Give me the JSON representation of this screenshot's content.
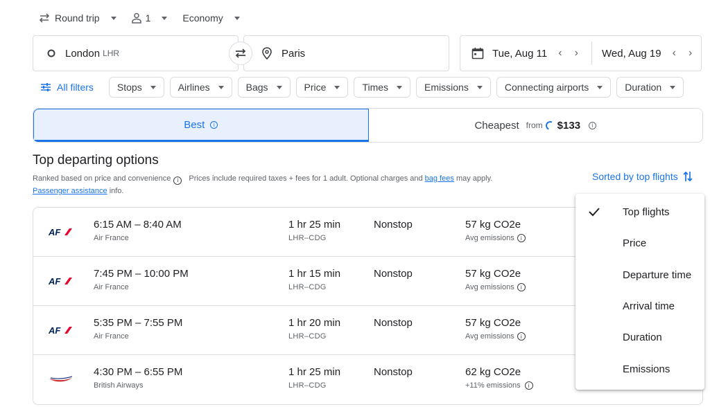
{
  "trip": {
    "type": "Round trip",
    "passengers": "1",
    "cabin": "Economy"
  },
  "search": {
    "origin": "London",
    "origin_code": "LHR",
    "destination": "Paris",
    "depart_date": "Tue, Aug 11",
    "return_date": "Wed, Aug 19"
  },
  "filters": {
    "all_filters": "All filters",
    "chips": [
      "Stops",
      "Airlines",
      "Bags",
      "Price",
      "Times",
      "Emissions",
      "Connecting airports",
      "Duration"
    ]
  },
  "tabs": {
    "best": "Best",
    "cheapest": "Cheapest",
    "from": "from",
    "cheapest_price": "$133"
  },
  "section": {
    "title": "Top departing options",
    "ranked": "Ranked based on price and convenience",
    "prices_note": "Prices include required taxes + fees for 1 adult. Optional charges and",
    "bag_fees": "bag fees",
    "may_apply": "may apply.",
    "passenger_assistance": "Passenger assistance",
    "info": "info.",
    "sorted_by": "Sorted by top flights"
  },
  "flights": [
    {
      "times": "6:15 AM – 8:40 AM",
      "airline": "Air France",
      "duration": "1 hr 25 min",
      "route": "LHR–CDG",
      "stops": "Nonstop",
      "emissions": "57 kg CO2e",
      "emissions_note": "Avg emissions"
    },
    {
      "times": "7:45 PM – 10:00 PM",
      "airline": "Air France",
      "duration": "1 hr 15 min",
      "route": "LHR–CDG",
      "stops": "Nonstop",
      "emissions": "57 kg CO2e",
      "emissions_note": "Avg emissions"
    },
    {
      "times": "5:35 PM – 7:55 PM",
      "airline": "Air France",
      "duration": "1 hr 20 min",
      "route": "LHR–CDG",
      "stops": "Nonstop",
      "emissions": "57 kg CO2e",
      "emissions_note": "Avg emissions"
    },
    {
      "times": "4:30 PM – 6:55 PM",
      "airline": "British Airways",
      "duration": "1 hr 25 min",
      "route": "LHR–CDG",
      "stops": "Nonstop",
      "emissions": "62 kg CO2e",
      "emissions_note": "+11% emissions"
    }
  ],
  "sort_menu": {
    "selected": "Top flights",
    "items": [
      "Top flights",
      "Price",
      "Departure time",
      "Arrival time",
      "Duration",
      "Emissions"
    ]
  },
  "logos": {
    "air_france": "AF"
  },
  "colors": {
    "accent": "#1a73e8",
    "air_france_blue": "#002157",
    "air_france_red": "#e4032e",
    "ba_red": "#cc2b2b",
    "ba_blue": "#1e3a8a"
  }
}
